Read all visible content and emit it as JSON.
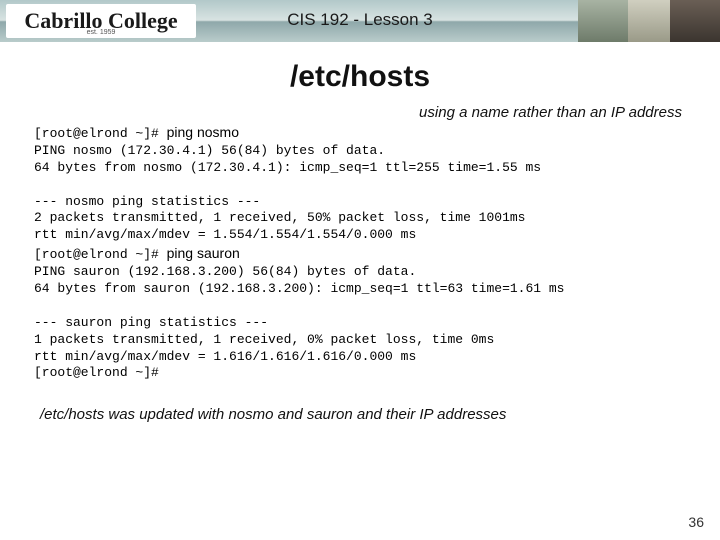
{
  "header": {
    "logo_text": "Cabrillo College",
    "logo_sub": "est. 1959",
    "course": "CIS 192 - Lesson 3"
  },
  "title": "/etc/hosts",
  "subtitle": "using a name rather than an IP address",
  "terminal": {
    "prompt1": "[root@elrond ~]# ",
    "cmd1": "ping nosmo",
    "block1": "PING nosmo (172.30.4.1) 56(84) bytes of data.\n64 bytes from nosmo (172.30.4.1): icmp_seq=1 ttl=255 time=1.55 ms\n\n--- nosmo ping statistics ---\n2 packets transmitted, 1 received, 50% packet loss, time 1001ms\nrtt min/avg/max/mdev = 1.554/1.554/1.554/0.000 ms",
    "prompt2": "[root@elrond ~]# ",
    "cmd2": "ping sauron",
    "block2": "PING sauron (192.168.3.200) 56(84) bytes of data.\n64 bytes from sauron (192.168.3.200): icmp_seq=1 ttl=63 time=1.61 ms\n\n--- sauron ping statistics ---\n1 packets transmitted, 1 received, 0% packet loss, time 0ms\nrtt min/avg/max/mdev = 1.616/1.616/1.616/0.000 ms\n[root@elrond ~]#"
  },
  "footnote": "/etc/hosts was updated with nosmo and sauron and their IP addresses",
  "page_number": "36"
}
